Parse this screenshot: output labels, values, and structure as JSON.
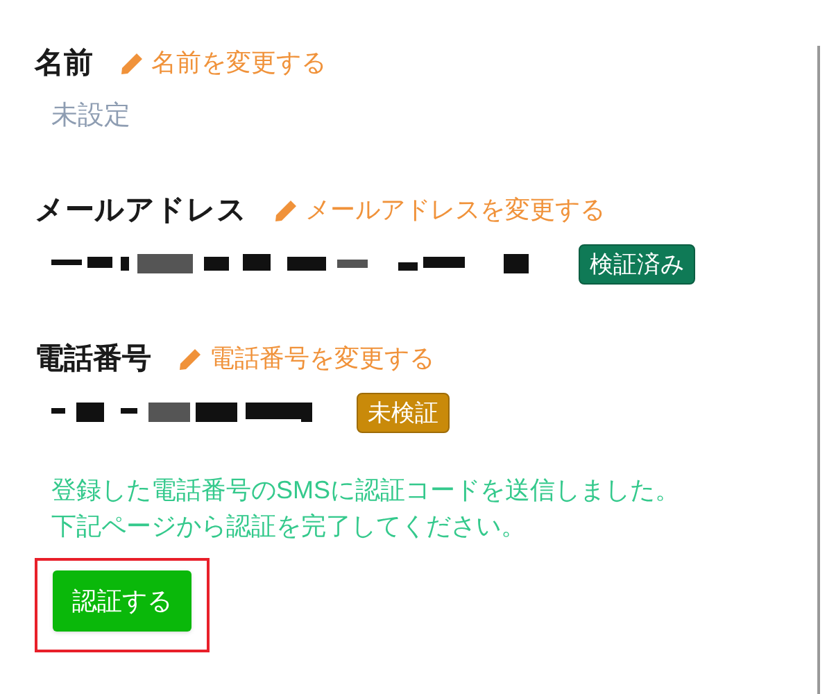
{
  "sections": [
    {
      "label": "名前",
      "edit_link": "名前を変更する",
      "value": "未設定",
      "kind": "text"
    },
    {
      "label": "メールアドレス",
      "edit_link": "メールアドレスを変更する",
      "kind": "redacted",
      "badge": {
        "text": "検証済み",
        "kind": "verified"
      }
    },
    {
      "label": "電話番号",
      "edit_link": "電話番号を変更する",
      "kind": "redacted",
      "badge": {
        "text": "未検証",
        "kind": "unverified"
      }
    }
  ],
  "notice": {
    "lines": [
      "登録した電話番号のSMSに認証コードを送信しました。",
      "下記ページから認証を完了してください。"
    ]
  },
  "verify_button": "認証する"
}
